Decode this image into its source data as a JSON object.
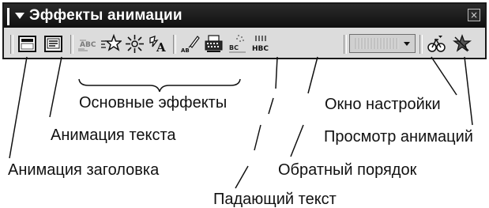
{
  "toolbar": {
    "title": "Эффекты анимации",
    "close_glyph": "×",
    "menu_icon": "menu-arrow-icon",
    "buttons": [
      {
        "id": "animate-title",
        "icon": "title-frame-icon"
      },
      {
        "id": "animate-text",
        "icon": "text-frame-icon"
      },
      {
        "id": "drive-in",
        "icon": "drive-in-icon"
      },
      {
        "id": "flying",
        "icon": "flying-star-icon"
      },
      {
        "id": "camera",
        "icon": "burst-icon"
      },
      {
        "id": "flash-once",
        "icon": "flash-a-icon"
      },
      {
        "id": "laser-text",
        "icon": "laser-text-icon"
      },
      {
        "id": "typewriter",
        "icon": "typewriter-icon"
      },
      {
        "id": "drop-in",
        "icon": "drop-in-icon"
      },
      {
        "id": "reverse-order",
        "icon": "reverse-order-icon"
      },
      {
        "id": "custom-animation",
        "icon": "custom-animation-icon"
      },
      {
        "id": "animation-preview",
        "icon": "preview-star-icon"
      }
    ],
    "order_combo_value": ""
  },
  "callouts": {
    "basic_effects": "Основные эффекты",
    "text_animation": "Анимация текста",
    "title_animation": "Анимация заголовка",
    "drop_text": "Падающий текст",
    "settings_window": "Окно настройки",
    "preview_animations": "Просмотр анимаций",
    "reverse_order": "Обратный порядок"
  }
}
